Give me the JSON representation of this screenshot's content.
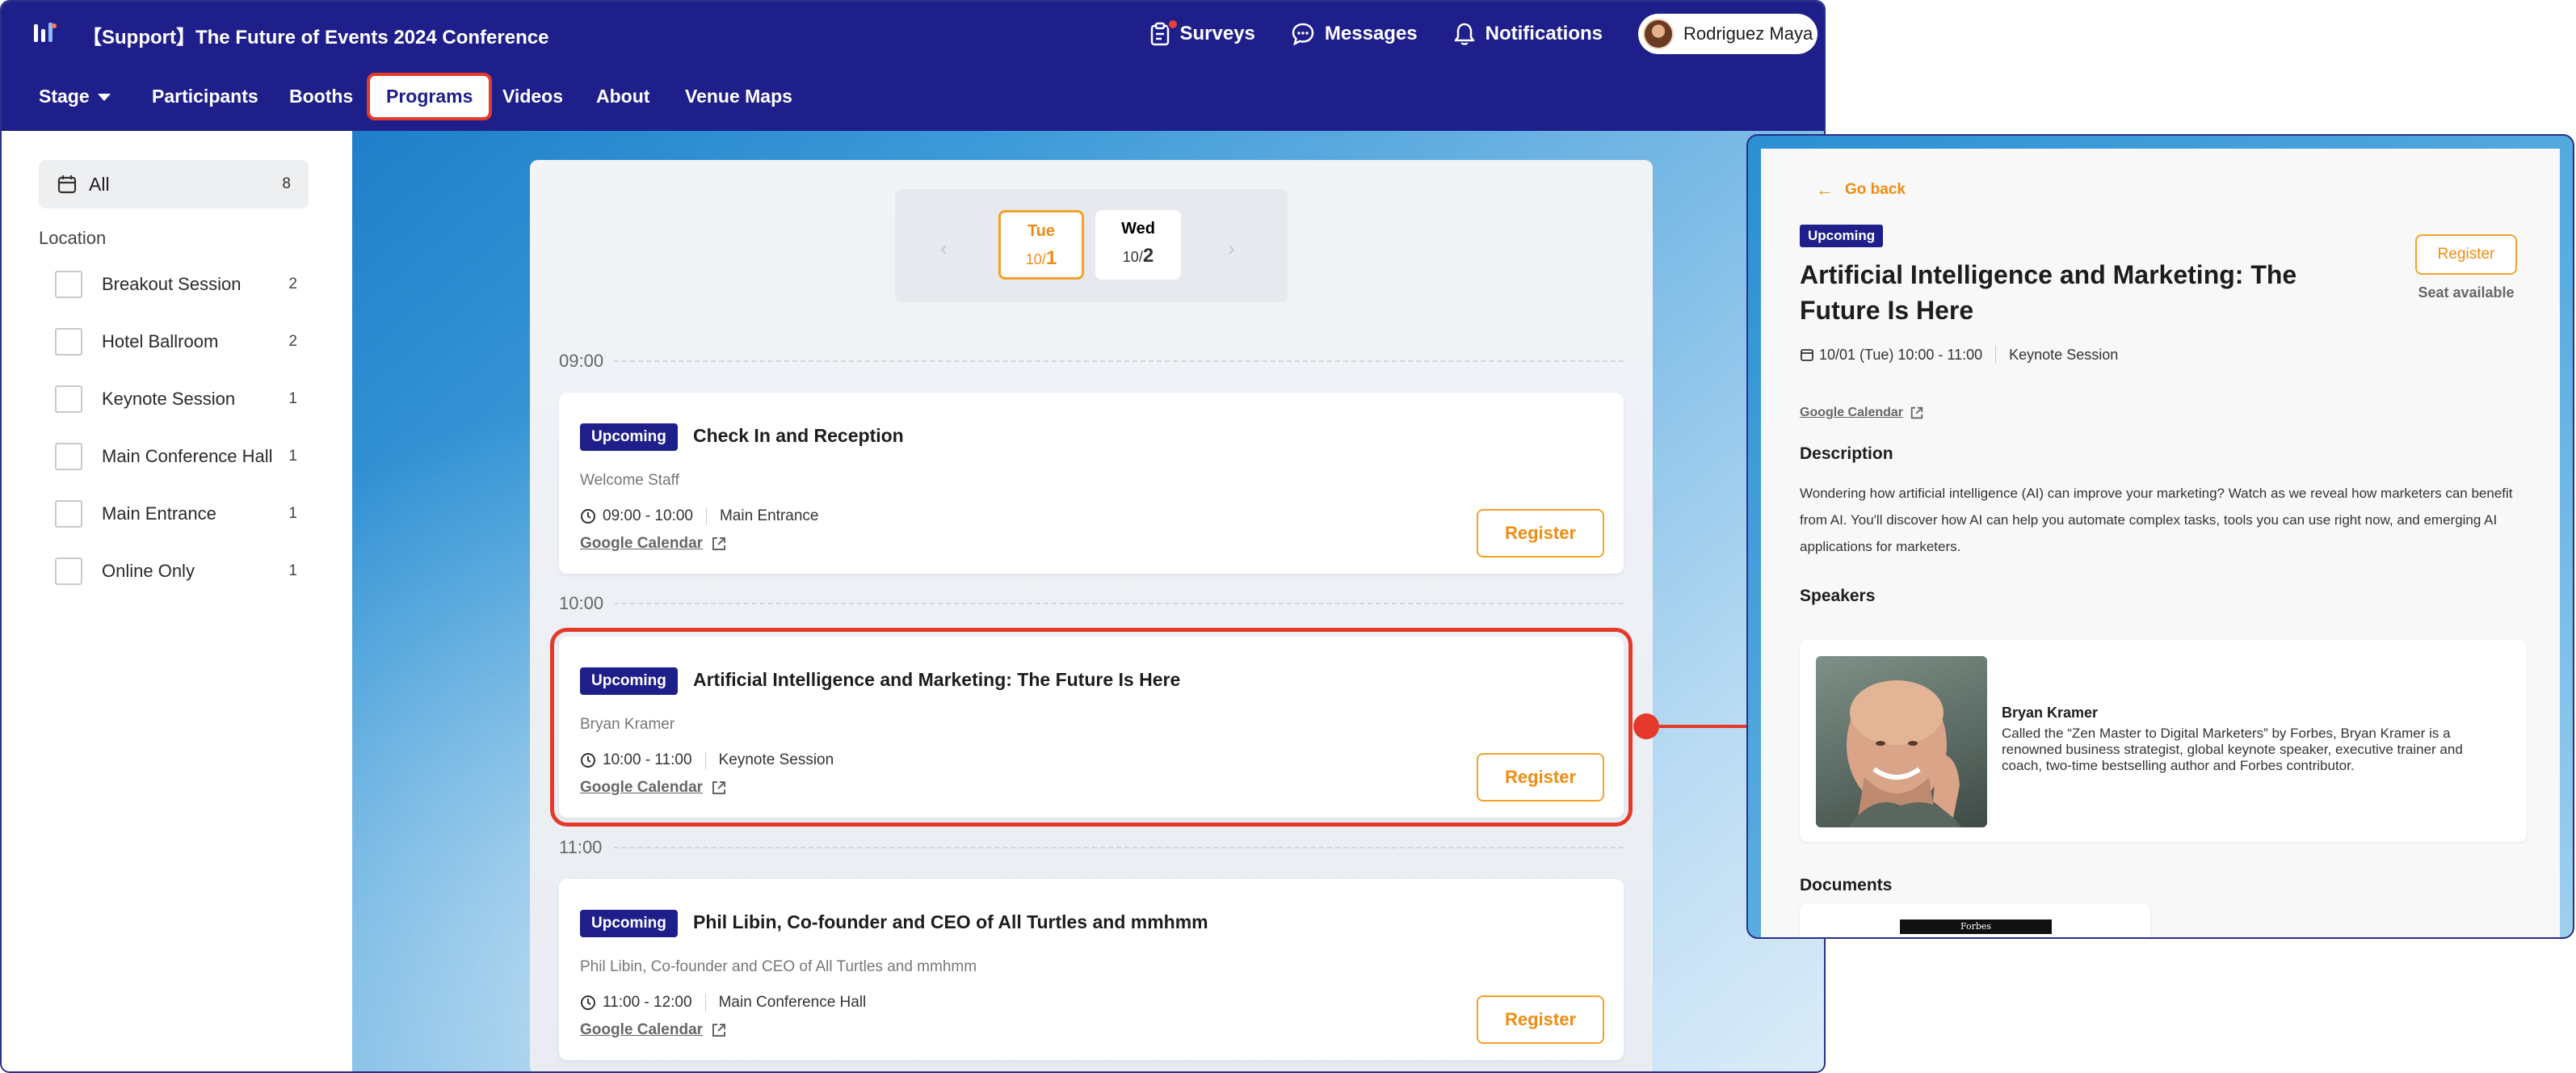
{
  "app": {
    "event_title": "【Support】The Future of Events 2024 Conference",
    "top_actions": {
      "surveys": "Surveys",
      "messages": "Messages",
      "notifications": "Notifications"
    },
    "user_name": "Rodriguez Maya"
  },
  "nav": {
    "stage": "Stage",
    "participants": "Participants",
    "booths": "Booths",
    "programs": "Programs",
    "videos": "Videos",
    "about": "About",
    "venue_maps": "Venue Maps",
    "active": "Programs"
  },
  "sidebar": {
    "all_label": "All",
    "all_count": "8",
    "location_heading": "Location",
    "locations": [
      {
        "label": "Breakout Session",
        "count": "2"
      },
      {
        "label": "Hotel Ballroom",
        "count": "2"
      },
      {
        "label": "Keynote Session",
        "count": "1"
      },
      {
        "label": "Main Conference Hall",
        "count": "1"
      },
      {
        "label": "Main Entrance",
        "count": "1"
      },
      {
        "label": "Online Only",
        "count": "1"
      }
    ]
  },
  "dates": [
    {
      "day": "Tue",
      "month": "10/",
      "date": "1",
      "selected": true
    },
    {
      "day": "Wed",
      "month": "10/",
      "date": "2",
      "selected": false
    }
  ],
  "schedule": {
    "times": [
      "09:00",
      "10:00",
      "11:00"
    ],
    "sessions": [
      {
        "badge": "Upcoming",
        "title": "Check In and Reception",
        "speaker": "Welcome Staff",
        "time": "09:00 - 10:00",
        "location": "Main Entrance",
        "calendar": "Google Calendar",
        "register": "Register"
      },
      {
        "badge": "Upcoming",
        "title": "Artificial Intelligence and Marketing: The Future Is Here",
        "speaker": "Bryan Kramer",
        "time": "10:00 - 11:00",
        "location": "Keynote Session",
        "calendar": "Google Calendar",
        "register": "Register"
      },
      {
        "badge": "Upcoming",
        "title": "Phil Libin, Co-founder and CEO of All Turtles and mmhmm",
        "speaker": "Phil Libin, Co-founder and CEO of All Turtles and mmhmm",
        "time": "11:00 - 12:00",
        "location": "Main Conference Hall",
        "calendar": "Google Calendar",
        "register": "Register"
      }
    ]
  },
  "detail": {
    "go_back": "Go back",
    "badge": "Upcoming",
    "title": "Artificial Intelligence and Marketing: The Future Is Here",
    "register": "Register",
    "seat": "Seat available",
    "datetime": "10/01 (Tue) 10:00 - 11:00",
    "location": "Keynote Session",
    "calendar": "Google Calendar",
    "description_heading": "Description",
    "description": "Wondering how artificial intelligence (AI) can improve your marketing? Watch as we reveal how marketers can benefit from AI. You'll discover how AI can help you automate complex tasks, tools you can use right now, and emerging AI applications for marketers.",
    "speakers_heading": "Speakers",
    "speaker_name": "Bryan Kramer",
    "speaker_bio": "Called the “Zen Master to Digital Marketers” by Forbes, Bryan Kramer is a renowned business strategist, global keynote speaker, executive trainer and coach, two-time bestselling author and Forbes contributor.",
    "documents_heading": "Documents",
    "document_label": "Forbes"
  },
  "colors": {
    "brand_navy": "#1f1f8b",
    "accent_orange": "#f08c12",
    "highlight_red": "#e53a2b"
  }
}
